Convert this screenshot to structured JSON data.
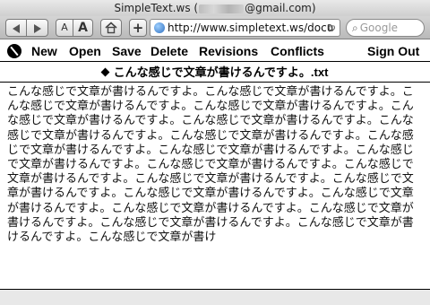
{
  "window": {
    "title_prefix": "SimpleText.ws (",
    "title_suffix": "@gmail.com)"
  },
  "toolbar": {
    "font_small": "A",
    "font_large": "A",
    "home_icon": "home-icon",
    "add_icon": "plus-icon",
    "url": "http://www.simpletext.ws/docu",
    "search_placeholder": "Google"
  },
  "menu": {
    "items": [
      "New",
      "Open",
      "Save",
      "Delete",
      "Revisions",
      "Conflicts"
    ],
    "sign_out": "Sign Out"
  },
  "document": {
    "title": "こんな感じで文章が書けるんですよ。.txt",
    "body": "こんな感じで文章が書けるんですよ。こんな感じで文章が書けるんですよ。こんな感じで文章が書けるんですよ。こんな感じで文章が書けるんですよ。こんな感じで文章が書けるんですよ。こんな感じで文章が書けるんですよ。こんな感じで文章が書けるんですよ。こんな感じで文章が書けるんですよ。こんな感じで文章が書けるんですよ。こんな感じで文章が書けるんですよ。こんな感じで文章が書けるんですよ。こんな感じで文章が書けるんですよ。こんな感じで文章が書けるんですよ。こんな感じで文章が書けるんですよ。こんな感じで文章が書けるんですよ。こんな感じで文章が書けるんですよ。こんな感じで文章が書けるんですよ。こんな感じで文章が書けるんですよ。こんな感じで文章が書けるんですよ。こんな感じで文章が書けるんですよ。こんな感じで文章が書けるんですよ。こんな感じで文章が書け"
  }
}
